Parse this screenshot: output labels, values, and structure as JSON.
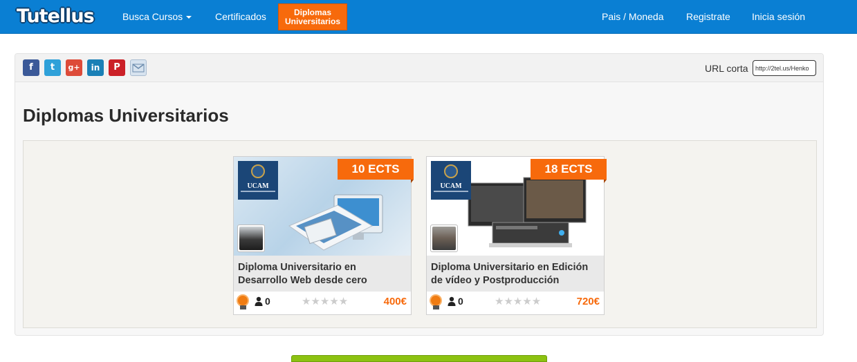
{
  "nav": {
    "logo": "Tutellus",
    "busca": "Busca Cursos",
    "certificados": "Certificados",
    "diplomas_line1": "Diplomas",
    "diplomas_line2": "Universitarios",
    "pais": "Pais / Moneda",
    "registrate": "Registrate",
    "login": "Inicia sesión"
  },
  "share": {
    "buttons": [
      "facebook-icon",
      "twitter-icon",
      "google-plus-icon",
      "linkedin-icon",
      "pinterest-icon",
      "email-icon"
    ],
    "colors": {
      "facebook": "#3b5998",
      "twitter": "#2fa1d9",
      "google_plus": "#dd4b39",
      "linkedin": "#1a80b6",
      "pinterest": "#cb2027",
      "email": "#d7e3ef"
    },
    "url_label": "URL corta",
    "url_value": "http://2tel.us/Henko"
  },
  "page_title": "Diplomas Universitarios",
  "courses": [
    {
      "ects": "10 ECTS",
      "title_line1": "Diploma Universitario en",
      "title_line2": "Desarrollo Web desde cero",
      "students": "0",
      "price": "400€",
      "rating_stars": 0,
      "stars": "★★★★★",
      "ucam": "UCAM"
    },
    {
      "ects": "18 ECTS",
      "title_line1": "Diploma Universitario en Edición",
      "title_line2": "de vídeo y Postproducción",
      "students": "0",
      "price": "720€",
      "rating_stars": 0,
      "stars": "★★★★★",
      "ucam": "UCAM"
    }
  ],
  "colors": {
    "brand_blue": "#0a7fd3",
    "accent_orange": "#f76a0c",
    "cta_green": "#8cc211"
  }
}
